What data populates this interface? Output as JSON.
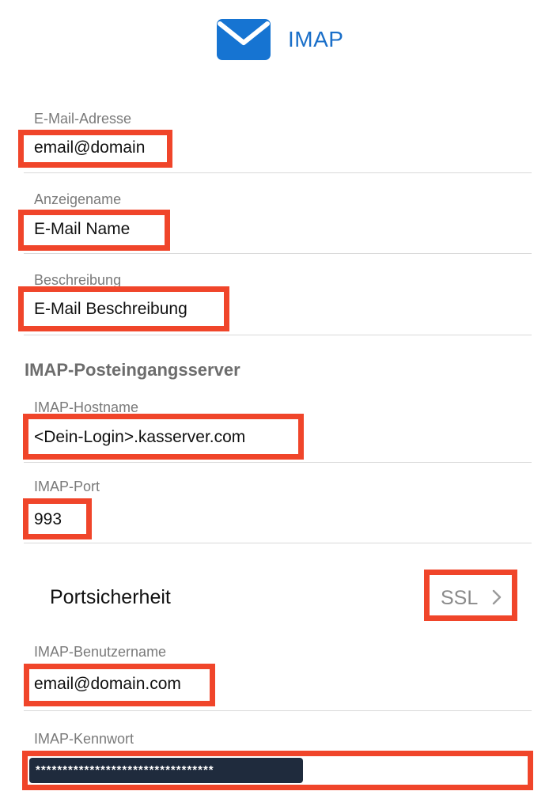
{
  "header": {
    "title": "IMAP",
    "icon": "mail-envelope-icon",
    "accent_color": "#1674d2"
  },
  "fields": {
    "email": {
      "label": "E-Mail-Adresse",
      "value": "email@domain"
    },
    "display_name": {
      "label": "Anzeigename",
      "value": "E-Mail Name"
    },
    "description": {
      "label": "Beschreibung",
      "value": "E-Mail Beschreibung"
    }
  },
  "imap_section": {
    "header": "IMAP-Posteingangsserver",
    "hostname": {
      "label": "IMAP-Hostname",
      "value": "<Dein-Login>.kasserver.com"
    },
    "port": {
      "label": "IMAP-Port",
      "value": "993"
    },
    "port_security": {
      "label": "Portsicherheit",
      "value": "SSL"
    },
    "username": {
      "label": "IMAP-Benutzername",
      "value": "email@domain.com"
    },
    "password": {
      "label": "IMAP-Kennwort",
      "value": "*********************************"
    }
  },
  "highlight_color": "#f0452a"
}
